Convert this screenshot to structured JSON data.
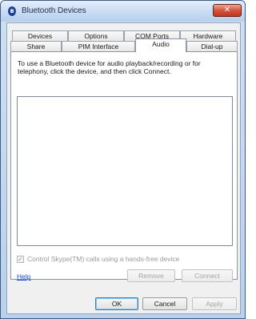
{
  "window": {
    "title": "Bluetooth Devices",
    "icon_glyph": "ʙ",
    "icon": "bluetooth-icon",
    "close_glyph": "✕"
  },
  "tabs": {
    "row1": [
      {
        "label": "Devices"
      },
      {
        "label": "Options"
      },
      {
        "label": "COM Ports"
      },
      {
        "label": "Hardware"
      }
    ],
    "row2": [
      {
        "label": "Share"
      },
      {
        "label": "PIM Interface"
      },
      {
        "label": "Audio",
        "selected": true
      },
      {
        "label": "Dial-up"
      }
    ]
  },
  "audio": {
    "instructions": "To use a Bluetooth device for audio playback/recording or for telephony, click the device, and then click Connect.",
    "device_list_items": [],
    "checkbox": {
      "label": "Control Skype(TM) calls using a hands-free device",
      "checked": true,
      "enabled": false,
      "check_glyph": "✓"
    },
    "help_link": "Help",
    "remove_button": "Remove",
    "connect_button": "Connect"
  },
  "footer": {
    "ok_button": "OK",
    "cancel_button": "Cancel",
    "apply_button": "Apply"
  },
  "colors": {
    "title_bar": "#c6daf2",
    "close_button": "#c0381f",
    "link": "#1a49c9",
    "disabled_text": "#a5a5a5"
  }
}
